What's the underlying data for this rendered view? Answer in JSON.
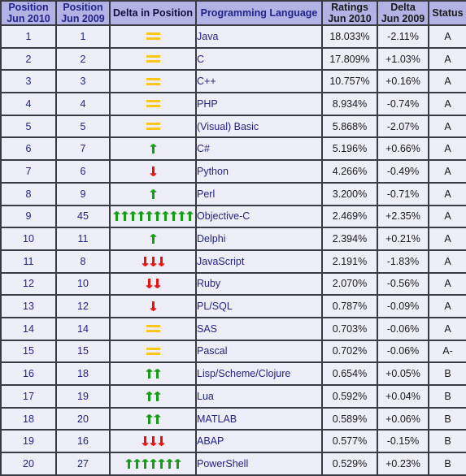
{
  "table": {
    "headers": [
      {
        "line1": "Position",
        "line2": "Jun 2010",
        "name": "position-2010"
      },
      {
        "line1": "Position",
        "line2": "Jun 2009",
        "name": "position-2009"
      },
      {
        "line1": "Delta in Position",
        "line2": "",
        "name": "delta-in-position"
      },
      {
        "line1": "Programming Language",
        "line2": "",
        "name": "programming-language"
      },
      {
        "line1": "Ratings",
        "line2": "Jun 2010",
        "name": "ratings-2010"
      },
      {
        "line1": "Delta",
        "line2": "Jun 2009",
        "name": "delta-2009"
      },
      {
        "line1": "Status",
        "line2": "",
        "name": "status"
      }
    ],
    "rows": [
      {
        "pos2010": "1",
        "pos2009": "1",
        "delta_icon": "equals",
        "delta_count": 1,
        "language": "Java",
        "rating": "18.033%",
        "delta_rating": "-2.11%",
        "status": "A"
      },
      {
        "pos2010": "2",
        "pos2009": "2",
        "delta_icon": "equals",
        "delta_count": 1,
        "language": "C",
        "rating": "17.809%",
        "delta_rating": "+1.03%",
        "status": "A"
      },
      {
        "pos2010": "3",
        "pos2009": "3",
        "delta_icon": "equals",
        "delta_count": 1,
        "language": "C++",
        "rating": "10.757%",
        "delta_rating": "+0.16%",
        "status": "A"
      },
      {
        "pos2010": "4",
        "pos2009": "4",
        "delta_icon": "equals",
        "delta_count": 1,
        "language": "PHP",
        "rating": "8.934%",
        "delta_rating": "-0.74%",
        "status": "A"
      },
      {
        "pos2010": "5",
        "pos2009": "5",
        "delta_icon": "equals",
        "delta_count": 1,
        "language": "(Visual) Basic",
        "rating": "5.868%",
        "delta_rating": "-2.07%",
        "status": "A"
      },
      {
        "pos2010": "6",
        "pos2009": "7",
        "delta_icon": "up",
        "delta_count": 1,
        "language": "C#",
        "rating": "5.196%",
        "delta_rating": "+0.66%",
        "status": "A"
      },
      {
        "pos2010": "7",
        "pos2009": "6",
        "delta_icon": "down",
        "delta_count": 1,
        "language": "Python",
        "rating": "4.266%",
        "delta_rating": "-0.49%",
        "status": "A"
      },
      {
        "pos2010": "8",
        "pos2009": "9",
        "delta_icon": "up",
        "delta_count": 1,
        "language": "Perl",
        "rating": "3.200%",
        "delta_rating": "-0.71%",
        "status": "A"
      },
      {
        "pos2010": "9",
        "pos2009": "45",
        "delta_icon": "up",
        "delta_count": 10,
        "language": "Objective-C",
        "rating": "2.469%",
        "delta_rating": "+2.35%",
        "status": "A"
      },
      {
        "pos2010": "10",
        "pos2009": "11",
        "delta_icon": "up",
        "delta_count": 1,
        "language": "Delphi",
        "rating": "2.394%",
        "delta_rating": "+0.21%",
        "status": "A"
      },
      {
        "pos2010": "11",
        "pos2009": "8",
        "delta_icon": "down",
        "delta_count": 3,
        "language": "JavaScript",
        "rating": "2.191%",
        "delta_rating": "-1.83%",
        "status": "A"
      },
      {
        "pos2010": "12",
        "pos2009": "10",
        "delta_icon": "down",
        "delta_count": 2,
        "language": "Ruby",
        "rating": "2.070%",
        "delta_rating": "-0.56%",
        "status": "A"
      },
      {
        "pos2010": "13",
        "pos2009": "12",
        "delta_icon": "down",
        "delta_count": 1,
        "language": "PL/SQL",
        "rating": "0.787%",
        "delta_rating": "-0.09%",
        "status": "A"
      },
      {
        "pos2010": "14",
        "pos2009": "14",
        "delta_icon": "equals",
        "delta_count": 1,
        "language": "SAS",
        "rating": "0.703%",
        "delta_rating": "-0.06%",
        "status": "A"
      },
      {
        "pos2010": "15",
        "pos2009": "15",
        "delta_icon": "equals",
        "delta_count": 1,
        "language": "Pascal",
        "rating": "0.702%",
        "delta_rating": "-0.06%",
        "status": "A-"
      },
      {
        "pos2010": "16",
        "pos2009": "18",
        "delta_icon": "up",
        "delta_count": 2,
        "language": "Lisp/Scheme/Clojure",
        "rating": "0.654%",
        "delta_rating": "+0.05%",
        "status": "B"
      },
      {
        "pos2010": "17",
        "pos2009": "19",
        "delta_icon": "up",
        "delta_count": 2,
        "language": "Lua",
        "rating": "0.592%",
        "delta_rating": "+0.04%",
        "status": "B"
      },
      {
        "pos2010": "18",
        "pos2009": "20",
        "delta_icon": "up",
        "delta_count": 2,
        "language": "MATLAB",
        "rating": "0.589%",
        "delta_rating": "+0.06%",
        "status": "B"
      },
      {
        "pos2010": "19",
        "pos2009": "16",
        "delta_icon": "down",
        "delta_count": 3,
        "language": "ABAP",
        "rating": "0.577%",
        "delta_rating": "-0.15%",
        "status": "B"
      },
      {
        "pos2010": "20",
        "pos2009": "27",
        "delta_icon": "up",
        "delta_count": 7,
        "language": "PowerShell",
        "rating": "0.529%",
        "delta_rating": "+0.23%",
        "status": "B"
      }
    ]
  },
  "colors": {
    "header_bg": "#b2b2e4",
    "row_bg": "#eeeef9",
    "border": "#3a3a42",
    "link_text": "#23238c",
    "arrow_up": "#179c17",
    "arrow_down": "#ee1111",
    "equals": "#ffc61a"
  }
}
